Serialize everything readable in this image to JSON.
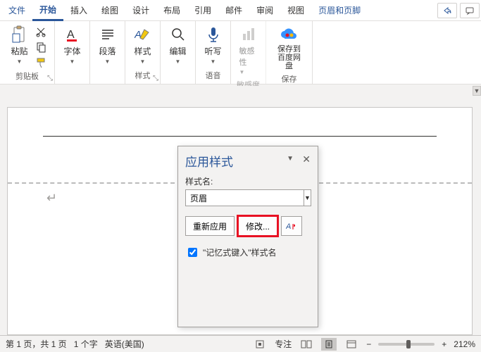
{
  "menu": {
    "file": "文件",
    "home": "开始",
    "insert": "插入",
    "draw": "绘图",
    "design": "设计",
    "layout": "布局",
    "references": "引用",
    "mailings": "邮件",
    "review": "审阅",
    "view": "视图",
    "hf": "页眉和页脚"
  },
  "ribbon": {
    "clipboard": {
      "paste": "粘贴",
      "label": "剪贴板"
    },
    "font": {
      "btn": "字体"
    },
    "paragraph": {
      "btn": "段落"
    },
    "styles": {
      "btn": "样式",
      "label": "样式"
    },
    "edit": {
      "btn": "编辑"
    },
    "dictate": {
      "btn": "听写",
      "label": "语音"
    },
    "sensitivity": {
      "btn": "敏感性",
      "label": "敏感度"
    },
    "save": {
      "btn": "保存到百度网盘",
      "label": "保存"
    }
  },
  "pane": {
    "title": "应用样式",
    "nameLabel": "样式名:",
    "value": "页眉",
    "reapply": "重新应用",
    "modify": "修改...",
    "checkbox": "\"记忆式键入\"样式名"
  },
  "status": {
    "page": "第 1 页，共 1 页",
    "words": "1 个字",
    "lang": "英语(美国)",
    "focus": "专注",
    "zoom": "212%"
  }
}
